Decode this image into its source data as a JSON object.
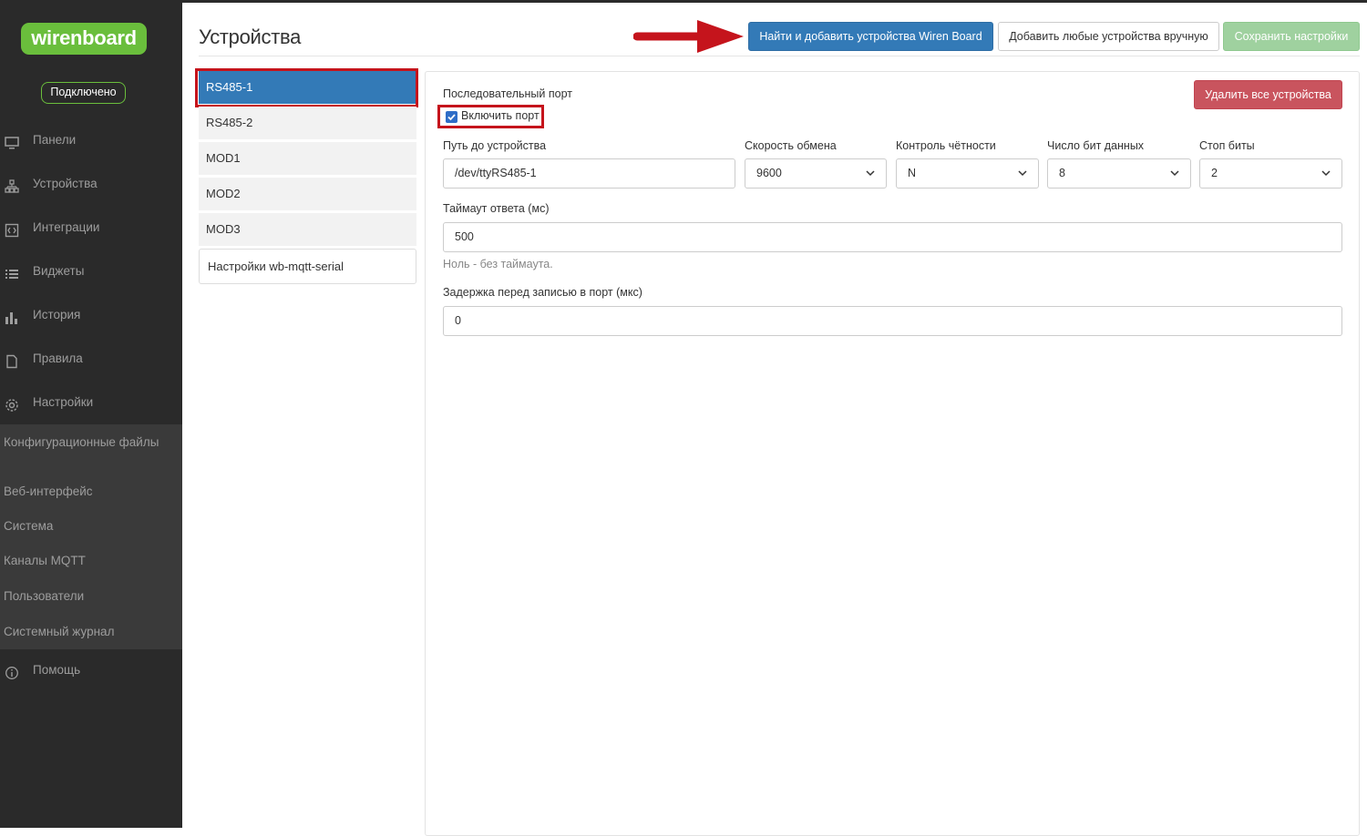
{
  "sidebar": {
    "logo": "wirenboard",
    "status": "Подключено",
    "items": [
      {
        "label": "Панели",
        "icon": "monitor-icon"
      },
      {
        "label": "Устройства",
        "icon": "devices-icon"
      },
      {
        "label": "Интеграции",
        "icon": "integrations-icon"
      },
      {
        "label": "Виджеты",
        "icon": "list-icon"
      },
      {
        "label": "История",
        "icon": "bar-chart-icon"
      },
      {
        "label": "Правила",
        "icon": "file-icon"
      },
      {
        "label": "Настройки",
        "icon": "gear-icon"
      }
    ],
    "submenu": [
      "Конфигурационные файлы",
      "Веб-интерфейс",
      "Система",
      "Каналы MQTT",
      "Пользователи",
      "Системный журнал"
    ],
    "help": {
      "label": "Помощь",
      "icon": "info-icon"
    }
  },
  "header": {
    "title": "Устройства",
    "buttons": {
      "find_devices": "Найти и добавить устройства Wiren Board",
      "add_manual": "Добавить любые устройства вручную",
      "save": "Сохранить настройки"
    }
  },
  "ports": [
    "RS485-1",
    "RS485-2",
    "MOD1",
    "MOD2",
    "MOD3"
  ],
  "selected_port": "RS485-1",
  "settings_item": "Настройки wb-mqtt-serial",
  "panel": {
    "section_title": "Последовательный порт",
    "enable_label": "Включить порт",
    "enable_checked": true,
    "delete_all": "Удалить все устройства",
    "fields": {
      "path": {
        "label": "Путь до устройства",
        "value": "/dev/ttyRS485-1"
      },
      "baud": {
        "label": "Скорость обмена",
        "value": "9600"
      },
      "parity": {
        "label": "Контроль чётности",
        "value": "N"
      },
      "data_bits": {
        "label": "Число бит данных",
        "value": "8"
      },
      "stop_bits": {
        "label": "Стоп биты",
        "value": "2"
      },
      "timeout": {
        "label": "Таймаут ответа (мс)",
        "value": "500",
        "help": "Ноль - без таймаута."
      },
      "write_delay": {
        "label": "Задержка перед записью в порт (мкс)",
        "value": "0"
      }
    }
  },
  "colors": {
    "sidebar_bg": "#2a2a2a",
    "brand_green": "#6abe3c",
    "primary": "#337ab7",
    "danger": "#c9545e",
    "highlight": "#c5141c"
  }
}
